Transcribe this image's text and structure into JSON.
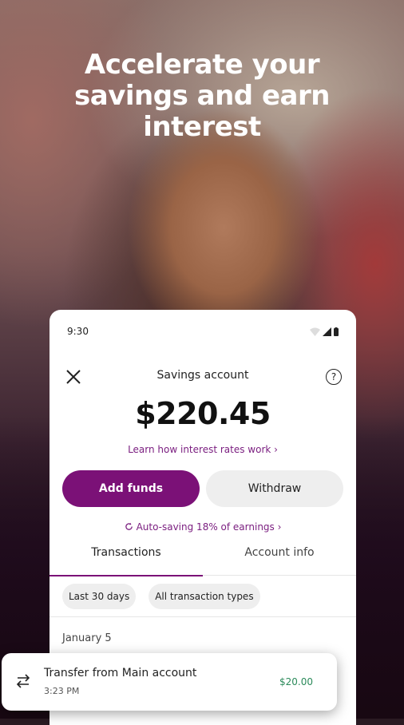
{
  "headline": {
    "line1": "Accelerate your",
    "line2": "savings and earn",
    "line3": "interest"
  },
  "status_bar": {
    "time": "9:30"
  },
  "header": {
    "title": "Savings account",
    "help": "?"
  },
  "balance": "$220.45",
  "learn_link": "Learn how interest rates work  ›",
  "buttons": {
    "add_funds": "Add funds",
    "withdraw": "Withdraw"
  },
  "auto_saving": "Auto-saving 18% of earnings  ›",
  "tabs": [
    {
      "label": "Transactions",
      "selected": true
    },
    {
      "label": "Account info",
      "selected": false
    }
  ],
  "filters": [
    "Last 30 days",
    "All transaction types"
  ],
  "date_group": "January 5",
  "transaction": {
    "name": "Transfer from Main account",
    "time": "3:23 PM",
    "amount": "$20.00"
  },
  "colors": {
    "accent": "#7b1177",
    "positive": "#2b8a5a"
  },
  "icons": [
    "close-icon",
    "help-icon",
    "wifi-icon",
    "signal-icon",
    "battery-icon",
    "sync-icon",
    "transfer-arrows-icon"
  ]
}
